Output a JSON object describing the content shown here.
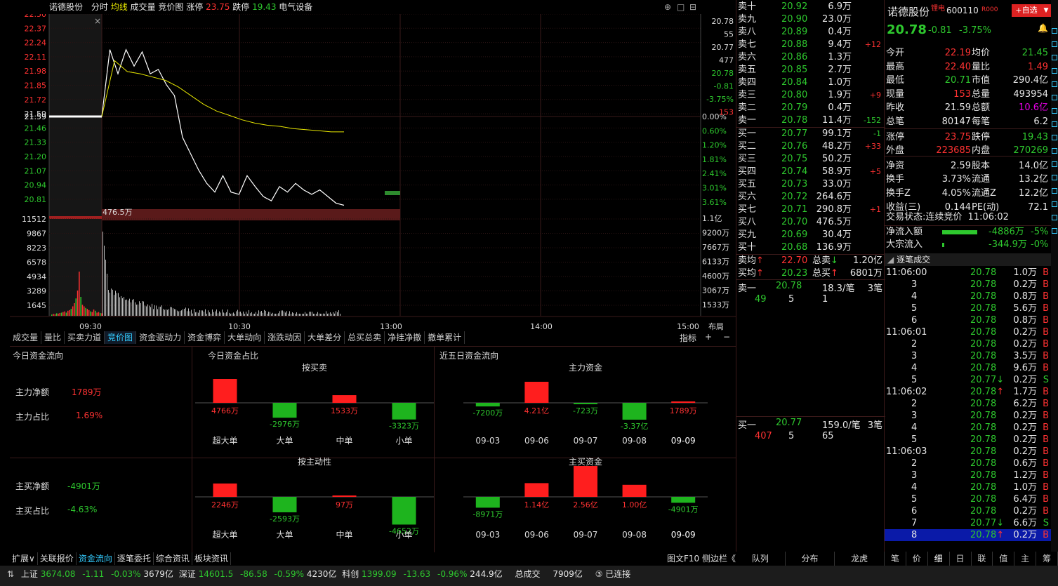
{
  "header": {
    "stock_name": "诺德股份",
    "tab_fenshi": "分时",
    "tab_junxian": "均线",
    "tab_volume": "成交量",
    "tab_auction": "竞价图",
    "limit_up_label": "涨停",
    "limit_up": "23.75",
    "limit_down_label": "跌停",
    "limit_down": "19.43",
    "sector": "电气设备"
  },
  "price_axis": {
    "left": [
      "22.50",
      "22.37",
      "22.24",
      "22.11",
      "21.98",
      "21.85",
      "21.72",
      "21.59",
      "21.46",
      "21.33",
      "21.20",
      "21.07",
      "20.94",
      "20.81"
    ],
    "right_pct": [
      "0.00%",
      "0.60%",
      "1.20%",
      "1.81%",
      "2.41%",
      "3.01%",
      "3.61%"
    ],
    "right_top": [
      "20.78",
      "55",
      "20.77",
      "477",
      "20.78",
      "-0.81",
      "-3.75%",
      "153"
    ],
    "ref_price": "21.59",
    "vol_mark": "476.5万"
  },
  "vol_axis": {
    "left": [
      "11512",
      "9867",
      "8223",
      "6578",
      "4934",
      "3289",
      "1645"
    ],
    "right": [
      "1.1亿",
      "9200万",
      "7667万",
      "6133万",
      "4600万",
      "3067万",
      "1533万"
    ]
  },
  "time_axis": [
    "09:30",
    "10:30",
    "13:00",
    "14:00",
    "15:00"
  ],
  "layout_btn": "布局",
  "indicator_btn": "指标",
  "sub_tabs": [
    "成交量",
    "量比",
    "买卖力道",
    "竞价图",
    "资金驱动力",
    "资金博弈",
    "大单动向",
    "涨跌动因",
    "大单差分",
    "总买总卖",
    "净挂净撤",
    "撤单累计"
  ],
  "fund": {
    "title_today": "今日资金流向",
    "title_ratio": "今日资金占比",
    "title_5day": "近五日资金流向",
    "main_net_label": "主力净额",
    "main_net": "1789万",
    "main_ratio_label": "主力占比",
    "main_ratio": "1.69%",
    "active_net_label": "主买净额",
    "active_net": "-4901万",
    "active_ratio_label": "主买占比",
    "active_ratio": "-4.63%",
    "by_trade_title": "按买卖",
    "by_active_title": "按主动性",
    "main_fund_title": "主力资金",
    "active_fund_title": "主买资金",
    "categories": [
      "超大单",
      "大单",
      "中单",
      "小单"
    ],
    "by_trade": [
      {
        "v": 4766,
        "t": "4766万"
      },
      {
        "v": -2976,
        "t": "-2976万"
      },
      {
        "v": 1533,
        "t": "1533万"
      },
      {
        "v": -3323,
        "t": "-3323万"
      }
    ],
    "by_active": [
      {
        "v": 2246,
        "t": "2246万"
      },
      {
        "v": -2593,
        "t": "-2593万"
      },
      {
        "v": 97,
        "t": "97万"
      },
      {
        "v": -4652,
        "t": "-4652万"
      }
    ],
    "dates": [
      "09-03",
      "09-06",
      "09-07",
      "09-08",
      "09-09"
    ],
    "main5": [
      {
        "v": -7200,
        "t": "-7200万"
      },
      {
        "v": 42100,
        "t": "4.21亿"
      },
      {
        "v": -723,
        "t": "-723万"
      },
      {
        "v": -33700,
        "t": "-3.37亿"
      },
      {
        "v": 1789,
        "t": "1789万"
      }
    ],
    "active5": [
      {
        "v": -8971,
        "t": "-8971万"
      },
      {
        "v": 11400,
        "t": "1.14亿"
      },
      {
        "v": 25600,
        "t": "2.56亿"
      },
      {
        "v": 10000,
        "t": "1.00亿"
      },
      {
        "v": -4901,
        "t": "-4901万"
      }
    ]
  },
  "orderbook": {
    "sell": [
      [
        "卖十",
        "20.92",
        "6.9万",
        ""
      ],
      [
        "卖九",
        "20.90",
        "23.0万",
        ""
      ],
      [
        "卖八",
        "20.89",
        "0.4万",
        ""
      ],
      [
        "卖七",
        "20.88",
        "9.4万",
        "+12"
      ],
      [
        "卖六",
        "20.86",
        "1.3万",
        ""
      ],
      [
        "卖五",
        "20.85",
        "2.7万",
        ""
      ],
      [
        "卖四",
        "20.84",
        "1.0万",
        ""
      ],
      [
        "卖三",
        "20.80",
        "1.9万",
        "+9"
      ],
      [
        "卖二",
        "20.79",
        "0.4万",
        ""
      ],
      [
        "卖一",
        "20.78",
        "11.4万",
        "-152"
      ]
    ],
    "buy": [
      [
        "买一",
        "20.77",
        "99.1万",
        "-1"
      ],
      [
        "买二",
        "20.76",
        "48.2万",
        "+33"
      ],
      [
        "买三",
        "20.75",
        "50.2万",
        ""
      ],
      [
        "买四",
        "20.74",
        "58.9万",
        "+5"
      ],
      [
        "买五",
        "20.73",
        "33.0万",
        ""
      ],
      [
        "买六",
        "20.72",
        "264.6万",
        ""
      ],
      [
        "买七",
        "20.71",
        "290.8万",
        "+1"
      ],
      [
        "买八",
        "20.70",
        "476.5万",
        ""
      ],
      [
        "买九",
        "20.69",
        "30.4万",
        ""
      ],
      [
        "买十",
        "20.68",
        "136.9万",
        ""
      ]
    ],
    "sell_avg_label": "卖均",
    "sell_avg": "22.70",
    "total_sell_label": "总卖",
    "total_sell": "1.20亿",
    "buy_avg_label": "买均",
    "buy_avg": "20.23",
    "total_buy_label": "总买",
    "total_buy": "6801万",
    "sell1_label": "卖一",
    "sell1_price": "20.78",
    "sell1_vol": "18.3/笔",
    "sell1_cnt": "3笔",
    "sell1_q": [
      "49",
      "5",
      "1"
    ],
    "buy1_label": "买一",
    "buy1_price": "20.77",
    "buy1_vol": "159.0/笔",
    "buy1_cnt": "3笔",
    "buy1_q": [
      "407",
      "5",
      "65"
    ],
    "bottom_tabs": [
      "队列",
      "分布",
      "龙虎"
    ]
  },
  "quote": {
    "name": "诺德股份",
    "tag": "锂电",
    "code": "600110",
    "code_suffix": "R000",
    "add_btn": "+自选",
    "price": "20.78",
    "change": "-0.81",
    "pct": "-3.75%",
    "rows": [
      [
        "今开",
        "22.19",
        "均价",
        "21.45"
      ],
      [
        "最高",
        "22.40",
        "量比",
        "1.49"
      ],
      [
        "最低",
        "20.71",
        "市值",
        "290.4亿"
      ],
      [
        "现量",
        "153",
        "总量",
        "493954"
      ],
      [
        "昨收",
        "21.59",
        "总额",
        "10.6亿"
      ],
      [
        "总笔",
        "80147",
        "每笔",
        "6.2"
      ],
      [
        "涨停",
        "23.75",
        "跌停",
        "19.43"
      ],
      [
        "外盘",
        "223685",
        "内盘",
        "270269"
      ],
      [
        "净资",
        "2.59",
        "股本",
        "14.0亿"
      ],
      [
        "换手",
        "3.73%",
        "流通",
        "13.2亿"
      ],
      [
        "换手Z",
        "4.05%",
        "流通Z",
        "12.2亿"
      ],
      [
        "收益(三)",
        "0.144",
        "PE(动)",
        "72.1"
      ]
    ],
    "status_label": "交易状态:",
    "status": "连续竞价",
    "status_time": "11:06:02",
    "net_in_label": "净流入额",
    "net_in": "-4886万",
    "net_in_pct": "-5%",
    "block_in_label": "大宗流入",
    "block_in": "-344.9万",
    "block_in_pct": "-0%",
    "ticks_title": "逐笔成交",
    "ticks": [
      [
        "11:06:00",
        "20.78",
        "1.0万",
        "B",
        ""
      ],
      [
        "3",
        "20.78",
        "0.2万",
        "B",
        ""
      ],
      [
        "4",
        "20.78",
        "0.8万",
        "B",
        ""
      ],
      [
        "5",
        "20.78",
        "5.6万",
        "B",
        ""
      ],
      [
        "6",
        "20.78",
        "0.8万",
        "B",
        ""
      ],
      [
        "11:06:01",
        "20.78",
        "0.2万",
        "B",
        ""
      ],
      [
        "2",
        "20.78",
        "0.2万",
        "B",
        ""
      ],
      [
        "3",
        "20.78",
        "3.5万",
        "B",
        ""
      ],
      [
        "4",
        "20.78",
        "9.6万",
        "B",
        ""
      ],
      [
        "5",
        "20.77",
        "0.2万",
        "S",
        "dn"
      ],
      [
        "11:06:02",
        "20.78",
        "1.7万",
        "B",
        "up"
      ],
      [
        "2",
        "20.78",
        "6.2万",
        "B",
        ""
      ],
      [
        "3",
        "20.78",
        "0.2万",
        "B",
        ""
      ],
      [
        "4",
        "20.78",
        "0.2万",
        "B",
        ""
      ],
      [
        "5",
        "20.78",
        "0.2万",
        "B",
        ""
      ],
      [
        "11:06:03",
        "20.78",
        "0.2万",
        "B",
        ""
      ],
      [
        "2",
        "20.78",
        "0.6万",
        "B",
        ""
      ],
      [
        "3",
        "20.78",
        "1.2万",
        "B",
        ""
      ],
      [
        "4",
        "20.78",
        "1.0万",
        "B",
        ""
      ],
      [
        "5",
        "20.78",
        "6.4万",
        "B",
        ""
      ],
      [
        "6",
        "20.78",
        "0.2万",
        "B",
        ""
      ],
      [
        "7",
        "20.77",
        "6.6万",
        "S",
        "dn"
      ],
      [
        "8",
        "20.78",
        "0.2万",
        "B",
        "up"
      ]
    ],
    "right_tabs": [
      "笔",
      "价",
      "细",
      "日",
      "联",
      "值",
      "主",
      "筹"
    ]
  },
  "bottom_tabs": [
    "扩展∨",
    "关联报价",
    "资金流向",
    "逐笔委托",
    "综合资讯",
    "板块资讯"
  ],
  "bottom_right": "图文F10 侧边栏《",
  "statusbar": {
    "sh_label": "上证",
    "sh": "3674.08",
    "sh_chg": "-1.11",
    "sh_pct": "-0.03%",
    "sh_amt": "3679亿",
    "sz_label": "深证",
    "sz": "14601.5",
    "sz_chg": "-86.58",
    "sz_pct": "-0.59%",
    "sz_amt": "4230亿",
    "kc_label": "科创",
    "kc": "1399.09",
    "kc_chg": "-13.63",
    "kc_pct": "-0.96%",
    "kc_amt": "244.9亿",
    "total_label": "总成交",
    "total": "7909亿",
    "conn": "③ 已连接"
  },
  "chart_data": {
    "type": "line",
    "title": "分时",
    "x": [
      "09:30",
      "10:30",
      "13:00",
      "14:00",
      "15:00"
    ],
    "prev_close": 21.59,
    "ylim": [
      20.81,
      22.5
    ],
    "price": [
      21.59,
      22.2,
      21.98,
      22.2,
      22.05,
      22.18,
      21.98,
      22.02,
      21.88,
      21.78,
      21.4,
      21.25,
      21.1,
      20.98,
      20.9,
      21.05,
      20.9,
      20.88,
      21.05,
      20.95,
      20.86,
      20.82,
      20.95,
      20.9,
      20.98,
      20.92,
      20.88,
      20.92,
      20.86,
      20.8,
      20.78
    ],
    "avg": [
      21.59,
      22.1,
      22.0,
      21.98,
      21.95,
      21.92,
      21.86,
      21.78,
      21.7,
      21.64,
      21.6,
      21.56,
      21.53,
      21.51,
      21.5,
      21.48,
      21.47,
      21.46,
      21.45,
      21.45
    ]
  }
}
